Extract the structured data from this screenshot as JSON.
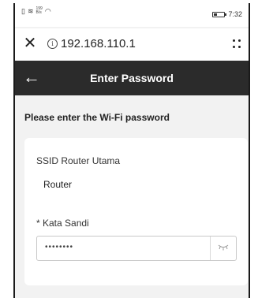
{
  "status_bar": {
    "speed_value": "199",
    "speed_unit": "B/s",
    "time": "7:32",
    "battery_level": 0.35
  },
  "browser": {
    "url": "192.168.110.1"
  },
  "header": {
    "title": "Enter Password"
  },
  "content": {
    "prompt": "Please enter the Wi-Fi password",
    "ssid_label": "SSID Router Utama",
    "ssid_value": "Router",
    "password_label": "* Kata Sandi",
    "password_value": "••••••••"
  },
  "colors": {
    "header_bg": "#2b2b2b",
    "page_bg": "#f2f2f2"
  }
}
